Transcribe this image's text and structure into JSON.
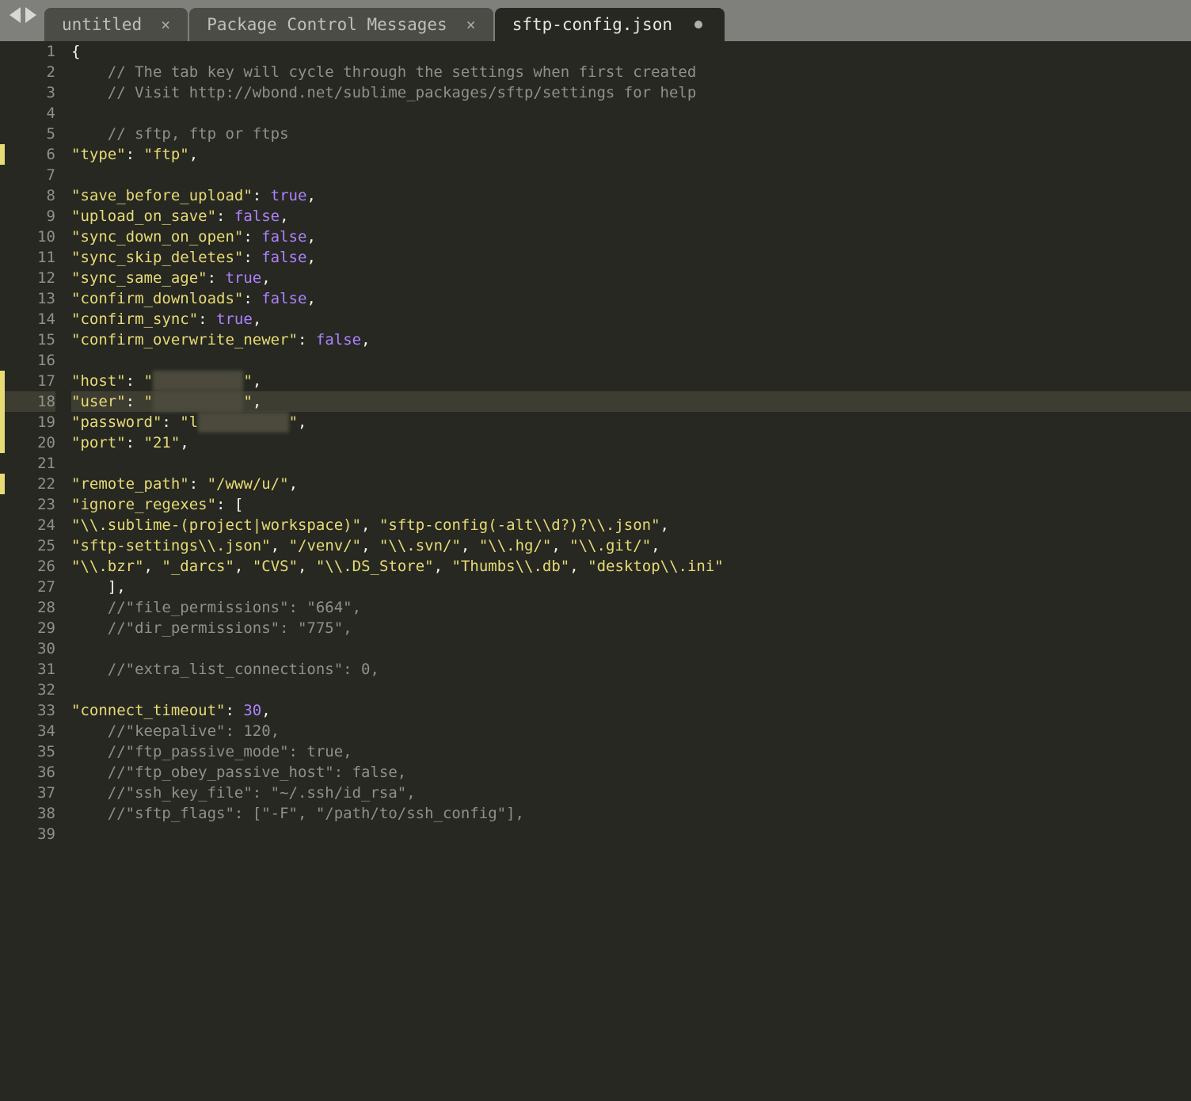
{
  "tabs": [
    {
      "label": "untitled",
      "state": "close"
    },
    {
      "label": "Package Control Messages",
      "state": "close"
    },
    {
      "label": "sftp-config.json",
      "state": "dirty",
      "active": true
    }
  ],
  "gutter": {
    "start": 1,
    "end": 39,
    "modified_lines": [
      6,
      17,
      18,
      19,
      20,
      22
    ],
    "current_line": 18
  },
  "code": {
    "l1": "{",
    "l2c": "    // The tab key will cycle through the settings when first created",
    "l3c": "    // Visit http://wbond.net/sublime_packages/sftp/settings for help",
    "l5c": "    // sftp, ftp or ftps",
    "l6": {
      "k": "\"type\"",
      "v": "\"ftp\""
    },
    "l8": {
      "k": "\"save_before_upload\"",
      "b": "true"
    },
    "l9": {
      "k": "\"upload_on_save\"",
      "b": "false"
    },
    "l10": {
      "k": "\"sync_down_on_open\"",
      "b": "false"
    },
    "l11": {
      "k": "\"sync_skip_deletes\"",
      "b": "false"
    },
    "l12": {
      "k": "\"sync_same_age\"",
      "b": "true"
    },
    "l13": {
      "k": "\"confirm_downloads\"",
      "b": "false"
    },
    "l14": {
      "k": "\"confirm_sync\"",
      "b": "true"
    },
    "l15": {
      "k": "\"confirm_overwrite_newer\"",
      "b": "false"
    },
    "l17": {
      "k": "\"host\"",
      "v": "\"            \"",
      "redacted": true
    },
    "l18": {
      "k": "\"user\"",
      "v": "\"            \"",
      "redacted": true
    },
    "l19": {
      "k": "\"password\"",
      "v": "\"l           \"",
      "redacted": true,
      "prefix": "l"
    },
    "l20": {
      "k": "\"port\"",
      "v": "\"21\""
    },
    "l22": {
      "k": "\"remote_path\"",
      "v": "\"/www/u/\""
    },
    "l23k": "\"ignore_regexes\"",
    "l23open": "[",
    "l24": [
      "\"\\\\.sublime-(project|workspace)\"",
      "\"sftp-config(-alt\\\\d?)?\\\\.json\""
    ],
    "l25": [
      "\"sftp-settings\\\\.json\"",
      "\"/venv/\"",
      "\"\\\\.svn/\"",
      "\"\\\\.hg/\"",
      "\"\\\\.git/\""
    ],
    "l26": [
      "\"\\\\.bzr\"",
      "\"_darcs\"",
      "\"CVS\"",
      "\"\\\\.DS_Store\"",
      "\"Thumbs\\\\.db\"",
      "\"desktop\\\\.ini\""
    ],
    "l27": "    ],",
    "l28c": "    //\"file_permissions\": \"664\",",
    "l29c": "    //\"dir_permissions\": \"775\",",
    "l31c": "    //\"extra_list_connections\": 0,",
    "l33": {
      "k": "\"connect_timeout\"",
      "n": "30"
    },
    "l34c": "    //\"keepalive\": 120,",
    "l35c": "    //\"ftp_passive_mode\": true,",
    "l36c": "    //\"ftp_obey_passive_host\": false,",
    "l37c": "    //\"ssh_key_file\": \"~/.ssh/id_rsa\",",
    "l38c": "    //\"sftp_flags\": [\"-F\", \"/path/to/ssh_config\"],"
  }
}
